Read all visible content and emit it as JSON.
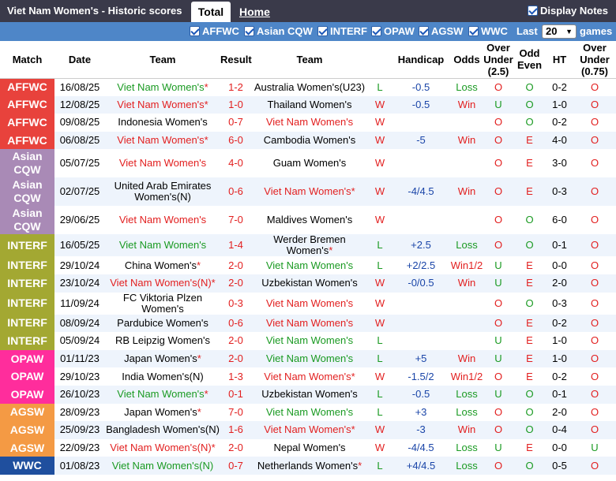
{
  "header": {
    "title": "Viet Nam Women's - Historic scores",
    "tab_total": "Total",
    "tab_home": "Home",
    "display_notes": "Display Notes"
  },
  "filters": {
    "items": [
      "AFFWC",
      "Asian CQW",
      "INTERF",
      "OPAW",
      "AGSW",
      "WWC"
    ],
    "last_label": "Last",
    "last_value": "20",
    "games_label": "games"
  },
  "columns": [
    "Match",
    "Date",
    "Team",
    "Result",
    "Team",
    "Handicap",
    "Odds",
    "Over Under (2.5)",
    "Odd Even",
    "HT",
    "Over Under (0.75)"
  ],
  "league_colors": {
    "AFFWC": "#e8423c",
    "Asian CQW": "#a98ab6",
    "INTERF": "#a3a832",
    "OPAW": "#ff2d9c",
    "AGSW": "#f49a44",
    "WWC": "#1f4f9e"
  },
  "rows": [
    {
      "league": "AFFWC",
      "date": "16/08/25",
      "home": "Viet Nam Women's",
      "home_star": "*",
      "home_color": "green",
      "score": "1-2",
      "away": "Australia Women's(U23)",
      "away_star": "",
      "away_color": "black",
      "wl": "L",
      "handicap": "-0.5",
      "odds": "Loss",
      "ou": "O",
      "oe": "O",
      "ht": "0-2",
      "ou2": "O"
    },
    {
      "league": "AFFWC",
      "date": "12/08/25",
      "home": "Viet Nam Women's",
      "home_star": "*",
      "home_color": "red",
      "score": "1-0",
      "away": "Thailand Women's",
      "away_star": "",
      "away_color": "black",
      "wl": "W",
      "handicap": "-0.5",
      "odds": "Win",
      "ou": "U",
      "oe": "O",
      "ht": "1-0",
      "ou2": "O"
    },
    {
      "league": "AFFWC",
      "date": "09/08/25",
      "home": "Indonesia Women's",
      "home_star": "",
      "home_color": "black",
      "score": "0-7",
      "away": "Viet Nam Women's",
      "away_star": "",
      "away_color": "red",
      "wl": "W",
      "handicap": "",
      "odds": "",
      "ou": "O",
      "oe": "O",
      "ht": "0-2",
      "ou2": "O"
    },
    {
      "league": "AFFWC",
      "date": "06/08/25",
      "home": "Viet Nam Women's",
      "home_star": "*",
      "home_color": "red",
      "score": "6-0",
      "away": "Cambodia Women's",
      "away_star": "",
      "away_color": "black",
      "wl": "W",
      "handicap": "-5",
      "odds": "Win",
      "ou": "O",
      "oe": "E",
      "ht": "4-0",
      "ou2": "O"
    },
    {
      "league": "Asian CQW",
      "date": "05/07/25",
      "home": "Viet Nam Women's",
      "home_star": "",
      "home_color": "red",
      "score": "4-0",
      "away": "Guam Women's",
      "away_star": "",
      "away_color": "black",
      "wl": "W",
      "handicap": "",
      "odds": "",
      "ou": "O",
      "oe": "E",
      "ht": "3-0",
      "ou2": "O"
    },
    {
      "league": "Asian CQW",
      "date": "02/07/25",
      "home": "United Arab Emirates Women's(N)",
      "home_star": "",
      "home_color": "black",
      "score": "0-6",
      "away": "Viet Nam Women's",
      "away_star": "*",
      "away_color": "red",
      "wl": "W",
      "handicap": "-4/4.5",
      "odds": "Win",
      "ou": "O",
      "oe": "E",
      "ht": "0-3",
      "ou2": "O"
    },
    {
      "league": "Asian CQW",
      "date": "29/06/25",
      "home": "Viet Nam Women's",
      "home_star": "",
      "home_color": "red",
      "score": "7-0",
      "away": "Maldives Women's",
      "away_star": "",
      "away_color": "black",
      "wl": "W",
      "handicap": "",
      "odds": "",
      "ou": "O",
      "oe": "O",
      "ht": "6-0",
      "ou2": "O"
    },
    {
      "league": "INTERF",
      "date": "16/05/25",
      "home": "Viet Nam Women's",
      "home_star": "",
      "home_color": "green",
      "score": "1-4",
      "away": "Werder Bremen Women's",
      "away_star": "*",
      "away_color": "black",
      "wl": "L",
      "handicap": "+2.5",
      "odds": "Loss",
      "ou": "O",
      "oe": "O",
      "ht": "0-1",
      "ou2": "O"
    },
    {
      "league": "INTERF",
      "date": "29/10/24",
      "home": "China Women's",
      "home_star": "*",
      "home_color": "black",
      "score": "2-0",
      "away": "Viet Nam Women's",
      "away_star": "",
      "away_color": "green",
      "wl": "L",
      "handicap": "+2/2.5",
      "odds": "Win1/2",
      "ou": "U",
      "oe": "E",
      "ht": "0-0",
      "ou2": "O"
    },
    {
      "league": "INTERF",
      "date": "23/10/24",
      "home": "Viet Nam Women's(N)",
      "home_star": "*",
      "home_color": "red",
      "score": "2-0",
      "away": "Uzbekistan Women's",
      "away_star": "",
      "away_color": "black",
      "wl": "W",
      "handicap": "-0/0.5",
      "odds": "Win",
      "ou": "U",
      "oe": "E",
      "ht": "2-0",
      "ou2": "O"
    },
    {
      "league": "INTERF",
      "date": "11/09/24",
      "home": "FC Viktoria Plzen Women's",
      "home_star": "",
      "home_color": "black",
      "score": "0-3",
      "away": "Viet Nam Women's",
      "away_star": "",
      "away_color": "red",
      "wl": "W",
      "handicap": "",
      "odds": "",
      "ou": "O",
      "oe": "O",
      "ht": "0-3",
      "ou2": "O"
    },
    {
      "league": "INTERF",
      "date": "08/09/24",
      "home": "Pardubice Women's",
      "home_star": "",
      "home_color": "black",
      "score": "0-6",
      "away": "Viet Nam Women's",
      "away_star": "",
      "away_color": "red",
      "wl": "W",
      "handicap": "",
      "odds": "",
      "ou": "O",
      "oe": "E",
      "ht": "0-2",
      "ou2": "O"
    },
    {
      "league": "INTERF",
      "date": "05/09/24",
      "home": "RB Leipzig Women's",
      "home_star": "",
      "home_color": "black",
      "score": "2-0",
      "away": "Viet Nam Women's",
      "away_star": "",
      "away_color": "green",
      "wl": "L",
      "handicap": "",
      "odds": "",
      "ou": "U",
      "oe": "E",
      "ht": "1-0",
      "ou2": "O"
    },
    {
      "league": "OPAW",
      "date": "01/11/23",
      "home": "Japan Women's",
      "home_star": "*",
      "home_color": "black",
      "score": "2-0",
      "away": "Viet Nam Women's",
      "away_star": "",
      "away_color": "green",
      "wl": "L",
      "handicap": "+5",
      "odds": "Win",
      "ou": "U",
      "oe": "E",
      "ht": "1-0",
      "ou2": "O"
    },
    {
      "league": "OPAW",
      "date": "29/10/23",
      "home": "India Women's(N)",
      "home_star": "",
      "home_color": "black",
      "score": "1-3",
      "away": "Viet Nam Women's",
      "away_star": "*",
      "away_color": "red",
      "wl": "W",
      "handicap": "-1.5/2",
      "odds": "Win1/2",
      "ou": "O",
      "oe": "E",
      "ht": "0-2",
      "ou2": "O"
    },
    {
      "league": "OPAW",
      "date": "26/10/23",
      "home": "Viet Nam Women's",
      "home_star": "*",
      "home_color": "green",
      "score": "0-1",
      "away": "Uzbekistan Women's",
      "away_star": "",
      "away_color": "black",
      "wl": "L",
      "handicap": "-0.5",
      "odds": "Loss",
      "ou": "U",
      "oe": "O",
      "ht": "0-1",
      "ou2": "O"
    },
    {
      "league": "AGSW",
      "date": "28/09/23",
      "home": "Japan Women's",
      "home_star": "*",
      "home_color": "black",
      "score": "7-0",
      "away": "Viet Nam Women's",
      "away_star": "",
      "away_color": "green",
      "wl": "L",
      "handicap": "+3",
      "odds": "Loss",
      "ou": "O",
      "oe": "O",
      "ht": "2-0",
      "ou2": "O"
    },
    {
      "league": "AGSW",
      "date": "25/09/23",
      "home": "Bangladesh Women's(N)",
      "home_star": "",
      "home_color": "black",
      "score": "1-6",
      "away": "Viet Nam Women's",
      "away_star": "*",
      "away_color": "red",
      "wl": "W",
      "handicap": "-3",
      "odds": "Win",
      "ou": "O",
      "oe": "O",
      "ht": "0-4",
      "ou2": "O"
    },
    {
      "league": "AGSW",
      "date": "22/09/23",
      "home": "Viet Nam Women's(N)",
      "home_star": "*",
      "home_color": "red",
      "score": "2-0",
      "away": "Nepal Women's",
      "away_star": "",
      "away_color": "black",
      "wl": "W",
      "handicap": "-4/4.5",
      "odds": "Loss",
      "ou": "U",
      "oe": "E",
      "ht": "0-0",
      "ou2": "U"
    },
    {
      "league": "WWC",
      "date": "01/08/23",
      "home": "Viet Nam Women's(N)",
      "home_star": "",
      "home_color": "green",
      "score": "0-7",
      "away": "Netherlands Women's",
      "away_star": "*",
      "away_color": "black",
      "wl": "L",
      "handicap": "+4/4.5",
      "odds": "Loss",
      "ou": "O",
      "oe": "O",
      "ht": "0-5",
      "ou2": "O"
    }
  ]
}
